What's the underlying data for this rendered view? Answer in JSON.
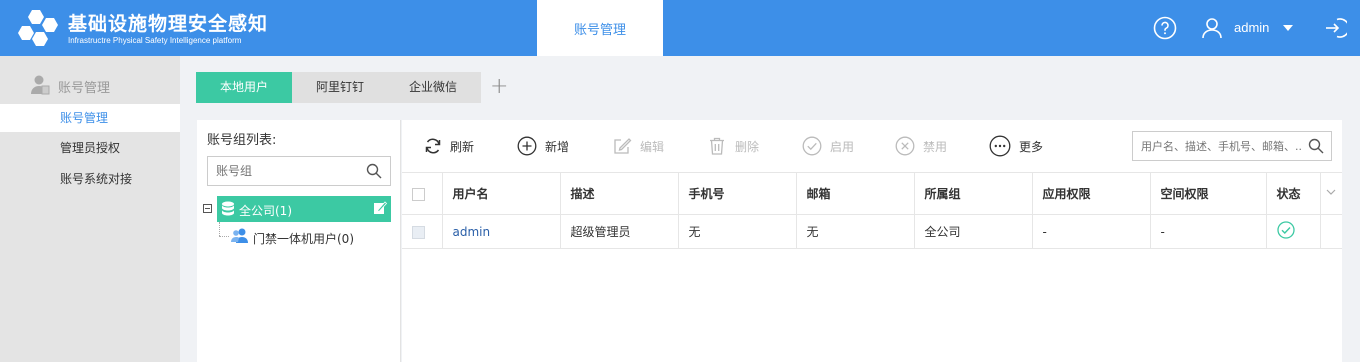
{
  "header": {
    "title": "基础设施物理安全感知",
    "subtitle": "Infrastructre Physical Safety Intelligence platform",
    "active_tab": "账号管理",
    "user": "admin"
  },
  "sidebar": {
    "group_label": "账号管理",
    "items": [
      {
        "label": "账号管理",
        "active": true
      },
      {
        "label": "管理员授权",
        "active": false
      },
      {
        "label": "账号系统对接",
        "active": false
      }
    ]
  },
  "subtabs": [
    {
      "label": "本地用户",
      "active": true
    },
    {
      "label": "阿里钉钉",
      "active": false
    },
    {
      "label": "企业微信",
      "active": false
    }
  ],
  "tree": {
    "title": "账号组列表:",
    "search_placeholder": "账号组",
    "root_label": "全公司(1)",
    "child_label": "门禁一体机用户(0)"
  },
  "toolbar": {
    "refresh": "刷新",
    "add": "新增",
    "edit": "编辑",
    "delete": "删除",
    "enable": "启用",
    "disable": "禁用",
    "more": "更多",
    "search_placeholder": "用户名、描述、手机号、邮箱、..."
  },
  "table": {
    "columns": [
      "用户名",
      "描述",
      "手机号",
      "邮箱",
      "所属组",
      "应用权限",
      "空间权限",
      "状态"
    ],
    "rows": [
      {
        "username": "admin",
        "desc": "超级管理员",
        "phone": "无",
        "email": "无",
        "group": "全公司",
        "app_perm": "-",
        "space_perm": "-",
        "status": "enabled"
      }
    ]
  },
  "colors": {
    "header_blue": "#3d8fe8",
    "teal": "#3cc9a3",
    "status_green": "#3cc9a3"
  }
}
